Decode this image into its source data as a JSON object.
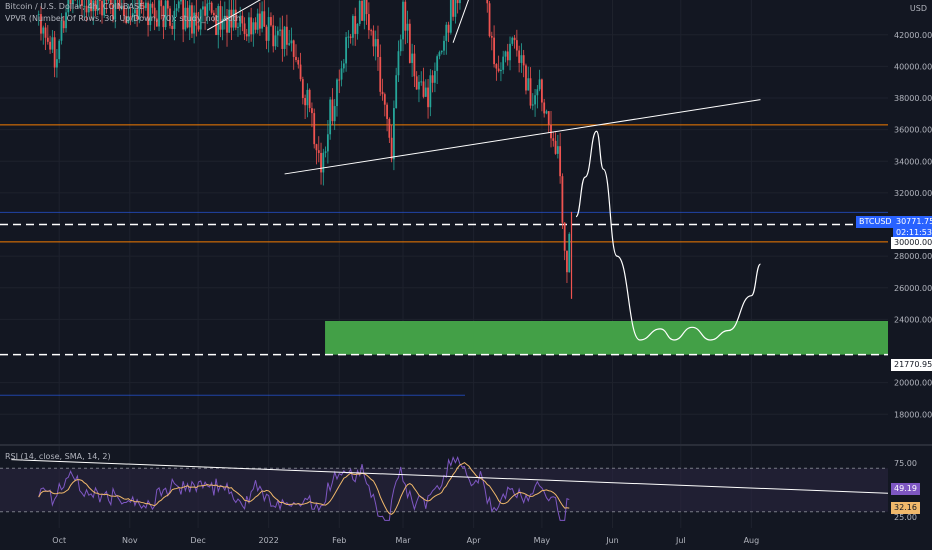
{
  "header": {
    "symbol_line": "Bitcoin / U.S. Dollar, 4h, COINBASE",
    "indicator_line": "VPVR (Number Of Rows, 30, Up/Down, 70): study_not_auth",
    "currency": "USD"
  },
  "price_badges": {
    "symbol": "BTCUSD",
    "last_price": "30771.75",
    "countdown": "02:11:53",
    "level_upper": "30000.00",
    "level_lower": "21770.95"
  },
  "rsi": {
    "label": "RSI (14, close, SMA, 14, 2)",
    "value": "49.19",
    "ma_value": "32.16",
    "ticks": [
      "75.00",
      "25.00"
    ],
    "colors": {
      "rsi": "#7e57c2",
      "ma": "#f0b86b",
      "band": "#2a2440"
    }
  },
  "colors": {
    "bg": "#131722",
    "grid": "#1e222d",
    "up": "#26a69a",
    "down": "#ef5350",
    "box": "#43a047",
    "orange": "#f57c00",
    "blue": "#2962ff",
    "white": "#ffffff",
    "axis_text": "#b2b5be"
  },
  "chart_data": {
    "type": "candlestick",
    "y_ticks": [
      "42000.00",
      "40000.00",
      "38000.00",
      "36000.00",
      "34000.00",
      "32000.00",
      "28000.00",
      "26000.00",
      "24000.00",
      "20000.00",
      "18000.00"
    ],
    "x_ticks": [
      "Oct",
      "Nov",
      "Dec",
      "2022",
      "Feb",
      "Mar",
      "Apr",
      "May",
      "Jun",
      "Jul",
      "Aug"
    ],
    "ylim": [
      16500,
      44200
    ],
    "candle_anchors": [
      [
        "2021-09-22",
        43500
      ],
      [
        "2021-09-29",
        41000
      ],
      [
        "2021-10-06",
        44500
      ],
      [
        "2021-10-15",
        44000
      ],
      [
        "2022-01-01",
        42500
      ],
      [
        "2022-01-10",
        41800
      ],
      [
        "2022-01-21",
        36000
      ],
      [
        "2022-01-24",
        33500
      ],
      [
        "2022-01-28",
        37000
      ],
      [
        "2022-02-05",
        41500
      ],
      [
        "2022-02-10",
        44000
      ],
      [
        "2022-02-15",
        42500
      ],
      [
        "2022-02-24",
        35000
      ],
      [
        "2022-03-01",
        43500
      ],
      [
        "2022-03-07",
        38500
      ],
      [
        "2022-03-14",
        38500
      ],
      [
        "2022-03-18",
        41500
      ],
      [
        "2022-03-28",
        46500
      ],
      [
        "2022-04-05",
        45500
      ],
      [
        "2022-04-11",
        39500
      ],
      [
        "2022-04-20",
        41500
      ],
      [
        "2022-04-26",
        38000
      ],
      [
        "2022-05-01",
        38500
      ],
      [
        "2022-05-05",
        36500
      ],
      [
        "2022-05-07",
        35500
      ],
      [
        "2022-05-10",
        31000
      ],
      [
        "2022-05-12",
        27000
      ],
      [
        "2022-05-14",
        30500
      ]
    ],
    "horizontal_levels": [
      {
        "price": 36300,
        "color": "orange"
      },
      {
        "price": 28900,
        "color": "orange"
      },
      {
        "price": 30000,
        "style": "dashed"
      },
      {
        "price": 21770.95,
        "style": "dashed"
      },
      {
        "price": 19200,
        "color": "blue"
      },
      {
        "price": 30771.75,
        "color": "blue"
      }
    ],
    "trendline": [
      [
        "2022-01-08",
        33200
      ],
      [
        "2022-08-05",
        37900
      ]
    ],
    "zone": {
      "from": "2022-01-24",
      "to": "2022-09-30",
      "low": 21770.95,
      "high": 23900
    },
    "projection": [
      [
        "2022-05-16",
        30500
      ],
      [
        "2022-05-20",
        33000
      ],
      [
        "2022-05-25",
        35900
      ],
      [
        "2022-05-28",
        33500
      ],
      [
        "2022-06-03",
        28000
      ],
      [
        "2022-06-13",
        22700
      ],
      [
        "2022-06-22",
        23400
      ],
      [
        "2022-06-28",
        22700
      ],
      [
        "2022-07-06",
        23500
      ],
      [
        "2022-07-14",
        22700
      ],
      [
        "2022-07-22",
        23300
      ],
      [
        "2022-08-01",
        25500
      ],
      [
        "2022-08-05",
        27500
      ]
    ],
    "rsi_ylim": [
      15,
      85
    ],
    "rsi_levels": [
      70,
      30
    ],
    "rsi_trendline": [
      [
        "2021-09-10",
        78
      ],
      [
        "2022-09-30",
        47
      ]
    ]
  }
}
